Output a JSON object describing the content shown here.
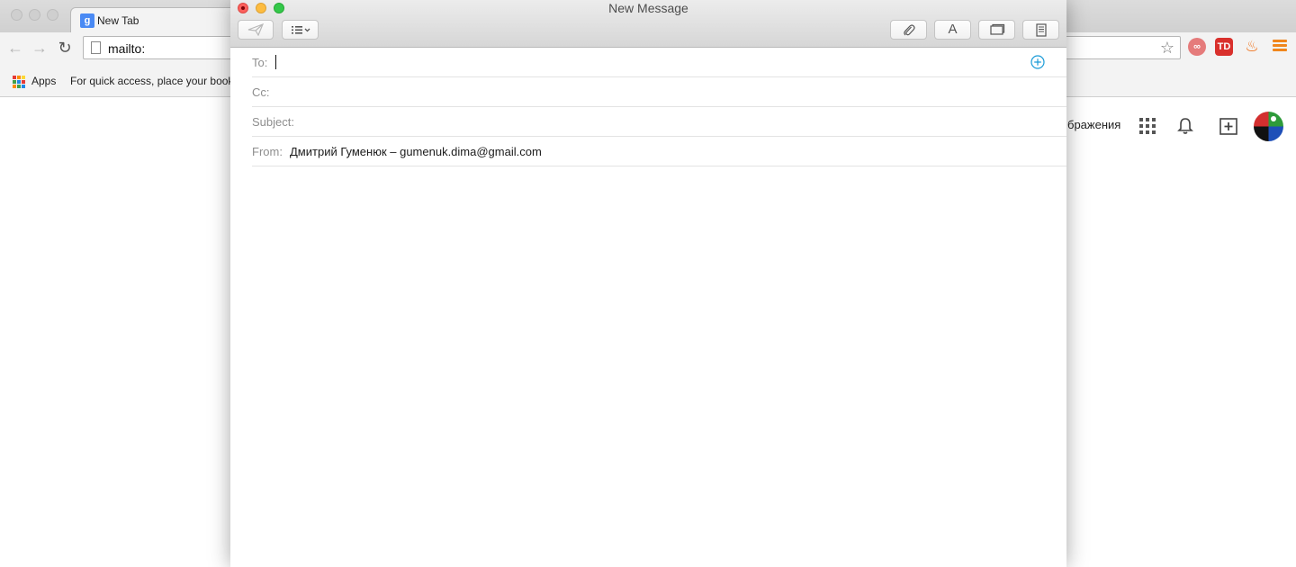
{
  "browser": {
    "tab_title": "New Tab",
    "tab_favicon": "g",
    "url": "mailto:",
    "bookmarks_apps_label": "Apps",
    "bookmarks_hint": "For quick access, place your book",
    "google_bar_text": "бражения",
    "ext_td_label": "TD"
  },
  "compose": {
    "title": "New Message",
    "toolbar": {
      "send_icon": "paper-plane-icon",
      "header_fields_icon": "list-icon",
      "attach_icon": "paperclip-icon",
      "format_label": "A",
      "photo_browser_icon": "photo-browser-icon",
      "stationery_icon": "stationery-icon"
    },
    "to_label": "To:",
    "to_value": "",
    "cc_label": "Cc:",
    "cc_value": "",
    "subject_label": "Subject:",
    "subject_value": "",
    "from_label": "From:",
    "from_value": "Дмитрий Гуменюк – gumenuk.dima@gmail.com",
    "body": ""
  },
  "colors": {
    "accent": "#1a9bd7",
    "close": "#fc605c",
    "minimize": "#fdbc40",
    "maximize": "#34c84a",
    "chrome_menu": "#f0861c"
  }
}
